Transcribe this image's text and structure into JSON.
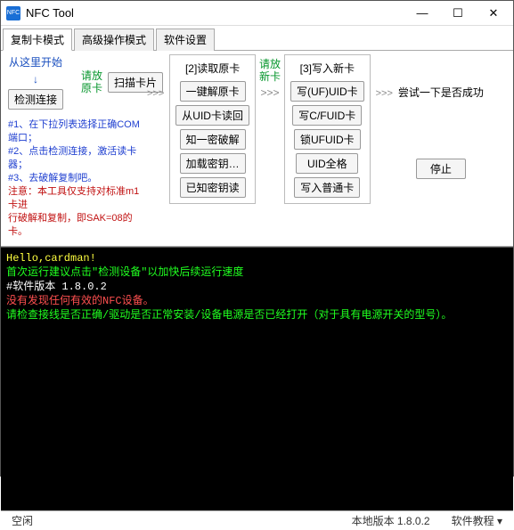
{
  "window": {
    "title": "NFC Tool",
    "icon_text": "NFC"
  },
  "tabs": {
    "t0": "复制卡模式",
    "t1": "高级操作模式",
    "t2": "软件设置"
  },
  "start": {
    "here": "从这里开始",
    "detect": "检测连接",
    "place": "请放\n原卡",
    "scan": "扫描卡片"
  },
  "legend": {
    "l1": "#1、在下拉列表选择正确COM端口；",
    "l2": "#2、点击检测连接，激活读卡器；",
    "l3": "#3、去破解复制吧。",
    "note1": "注意：本工具仅支持对标准m1卡进",
    "note2": "行破解和复制，即SAK=08的卡。"
  },
  "read": {
    "title": "[2]读取原卡",
    "b1": "一键解原卡",
    "b2": "从UID卡读回",
    "b3": "知一密破解",
    "b4": "加载密钥…",
    "b5": "已知密钥读"
  },
  "place2": "请放\n新卡",
  "write": {
    "title": "[3]写入新卡",
    "b1": "写(UF)UID卡",
    "b2": "写C/FUID卡",
    "b3": "锁UFUID卡",
    "b4": "UID全格",
    "b5": "写入普通卡"
  },
  "right": {
    "try": "尝试一下是否成功",
    "stop": "停止"
  },
  "log": {
    "l1": "Hello,cardman!",
    "l2": "首次运行建议点击\"检测设备\"以加快后续运行速度",
    "l3": "#软件版本 1.8.0.2",
    "l4": "没有发现任何有效的NFC设备。",
    "l5": "请检查接线是否正确/驱动是否正常安装/设备电源是否已经打开（对于具有电源开关的型号）。"
  },
  "status": {
    "idle": "空闲",
    "ver": "本地版本 1.8.0.2",
    "tut": "软件教程"
  }
}
